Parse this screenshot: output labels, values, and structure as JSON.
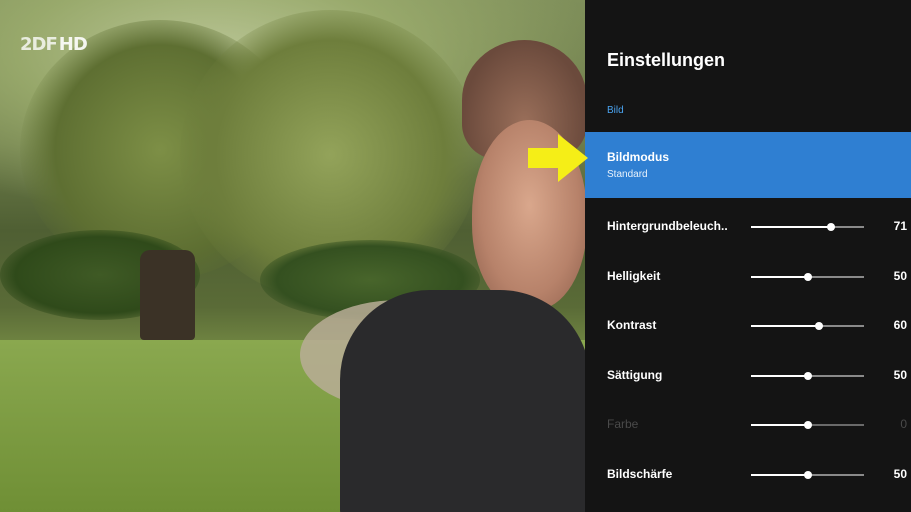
{
  "channel": {
    "logo_text": "2DF",
    "hd_text": "HD"
  },
  "settings": {
    "title": "Einstellungen",
    "section": "Bild",
    "selected": {
      "label": "Bildmodus",
      "value": "Standard"
    },
    "rows": [
      {
        "label": "Hintergrundbeleuch..",
        "value": "71",
        "level": 71,
        "enabled": true
      },
      {
        "label": "Helligkeit",
        "value": "50",
        "level": 50,
        "enabled": true
      },
      {
        "label": "Kontrast",
        "value": "60",
        "level": 60,
        "enabled": true
      },
      {
        "label": "Sättigung",
        "value": "50",
        "level": 50,
        "enabled": true
      },
      {
        "label": "Farbe",
        "value": "0",
        "level": 50,
        "enabled": false
      },
      {
        "label": "Bildschärfe",
        "value": "50",
        "level": 50,
        "enabled": true
      }
    ]
  },
  "colors": {
    "accent": "#2f7fd2",
    "section_label": "#4aa3f0",
    "arrow": "#f5ee17"
  },
  "icons": {
    "pointer": "yellow-arrow-right-icon"
  }
}
